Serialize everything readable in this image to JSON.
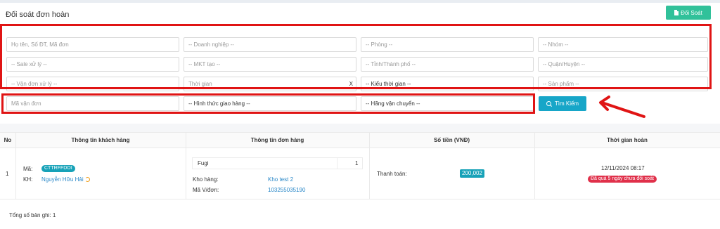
{
  "header": {
    "title": "Đối soát đơn hoàn",
    "doisoat_button": "Đối Soát"
  },
  "filters": {
    "row1": [
      "Họ tên, Số ĐT, Mã đơn",
      "-- Doanh nghiệp --",
      "-- Phòng --",
      "-- Nhóm --"
    ],
    "row2": [
      "-- Sale xử lý --",
      "-- MKT tạo --",
      "-- Tỉnh/Thành phố --",
      "-- Quận/Huyện --"
    ],
    "row3": [
      "-- Vận đơn xử lý --",
      "Thời gian",
      "-- Kiểu thời gian --",
      "-- Sản phẩm --"
    ],
    "row4": [
      "Mã vận đơn",
      "-- Hình thức giao hàng --",
      "-- Hãng vận chuyển --"
    ],
    "time_clear": "X",
    "search_button": "Tìm Kiếm"
  },
  "table": {
    "headers": [
      "No",
      "Thông tin khách hàng",
      "Thông tin đơn hàng",
      "Số tiền (VNĐ)",
      "Thời gian hoàn"
    ],
    "rows": [
      {
        "no": "1",
        "code_label": "Mã:",
        "code": "CTTRFFDOI",
        "customer_label": "KH:",
        "customer": "Nguyễn Hữu Hải",
        "product": "Fugi",
        "quantity": "1",
        "warehouse_label": "Kho hàng:",
        "warehouse": "Kho test 2",
        "tracking_label": "Mã V/đơn:",
        "tracking": "103255035190",
        "payment_label": "Thanh toán:",
        "amount": "200,002",
        "return_time": "12/11/2024 08:17",
        "status": "Đã quá 5 ngày chưa đối soát"
      }
    ]
  },
  "footer": {
    "total_label": "Tổng số bản ghi: 1"
  },
  "colors": {
    "accent_green": "#31c19a",
    "search_blue": "#17a6c8",
    "highlight_red": "#e01414",
    "badge_red": "#e0304a"
  }
}
